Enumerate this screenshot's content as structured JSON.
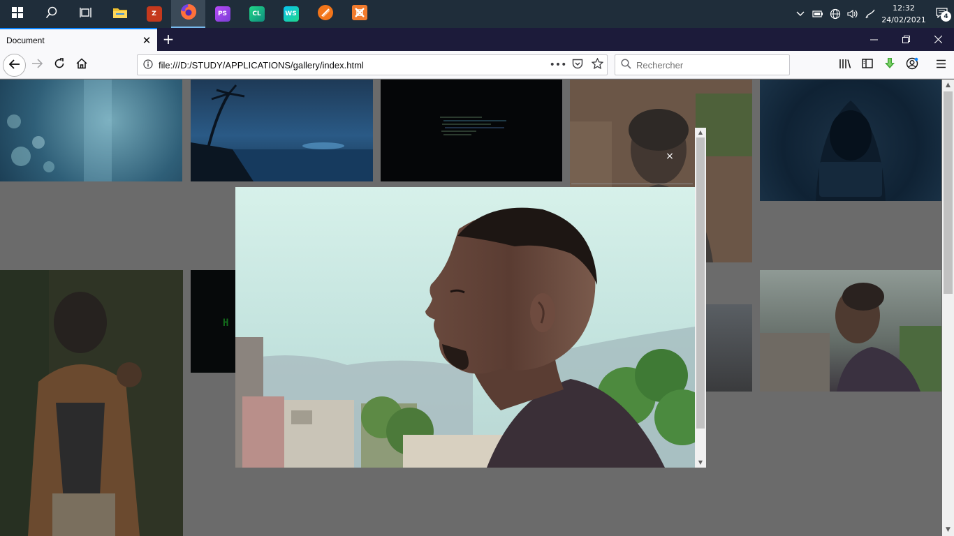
{
  "taskbar": {
    "start_icon": "windows-logo-icon",
    "search_icon": "search-icon",
    "task_view_icon": "task-view-icon",
    "apps": [
      {
        "name": "file-explorer",
        "glyph": "",
        "color": "#f2c230"
      },
      {
        "name": "filezilla",
        "glyph": "Z",
        "color": "#c5391d"
      },
      {
        "name": "firefox",
        "glyph": "",
        "color": "#ff7139"
      },
      {
        "name": "phpstorm",
        "glyph": "PS",
        "color": "#7a3fd6"
      },
      {
        "name": "clion",
        "glyph": "CL",
        "color": "#21d789"
      },
      {
        "name": "webstorm",
        "glyph": "WS",
        "color": "#0fb3e5"
      },
      {
        "name": "sublime",
        "glyph": "",
        "color": "#f2751a"
      },
      {
        "name": "xampp",
        "glyph": "",
        "color": "#f27b2d"
      }
    ],
    "clock": {
      "time": "12:32",
      "date": "24/02/2021"
    },
    "notification_count": "4"
  },
  "browser": {
    "tab_title": "Document",
    "url": "file:///D:/STUDY/APPLICATIONS/gallery/index.html",
    "search_placeholder": "Rechercher",
    "accent": "#0a84ff"
  },
  "modal": {
    "close_label": "×"
  }
}
